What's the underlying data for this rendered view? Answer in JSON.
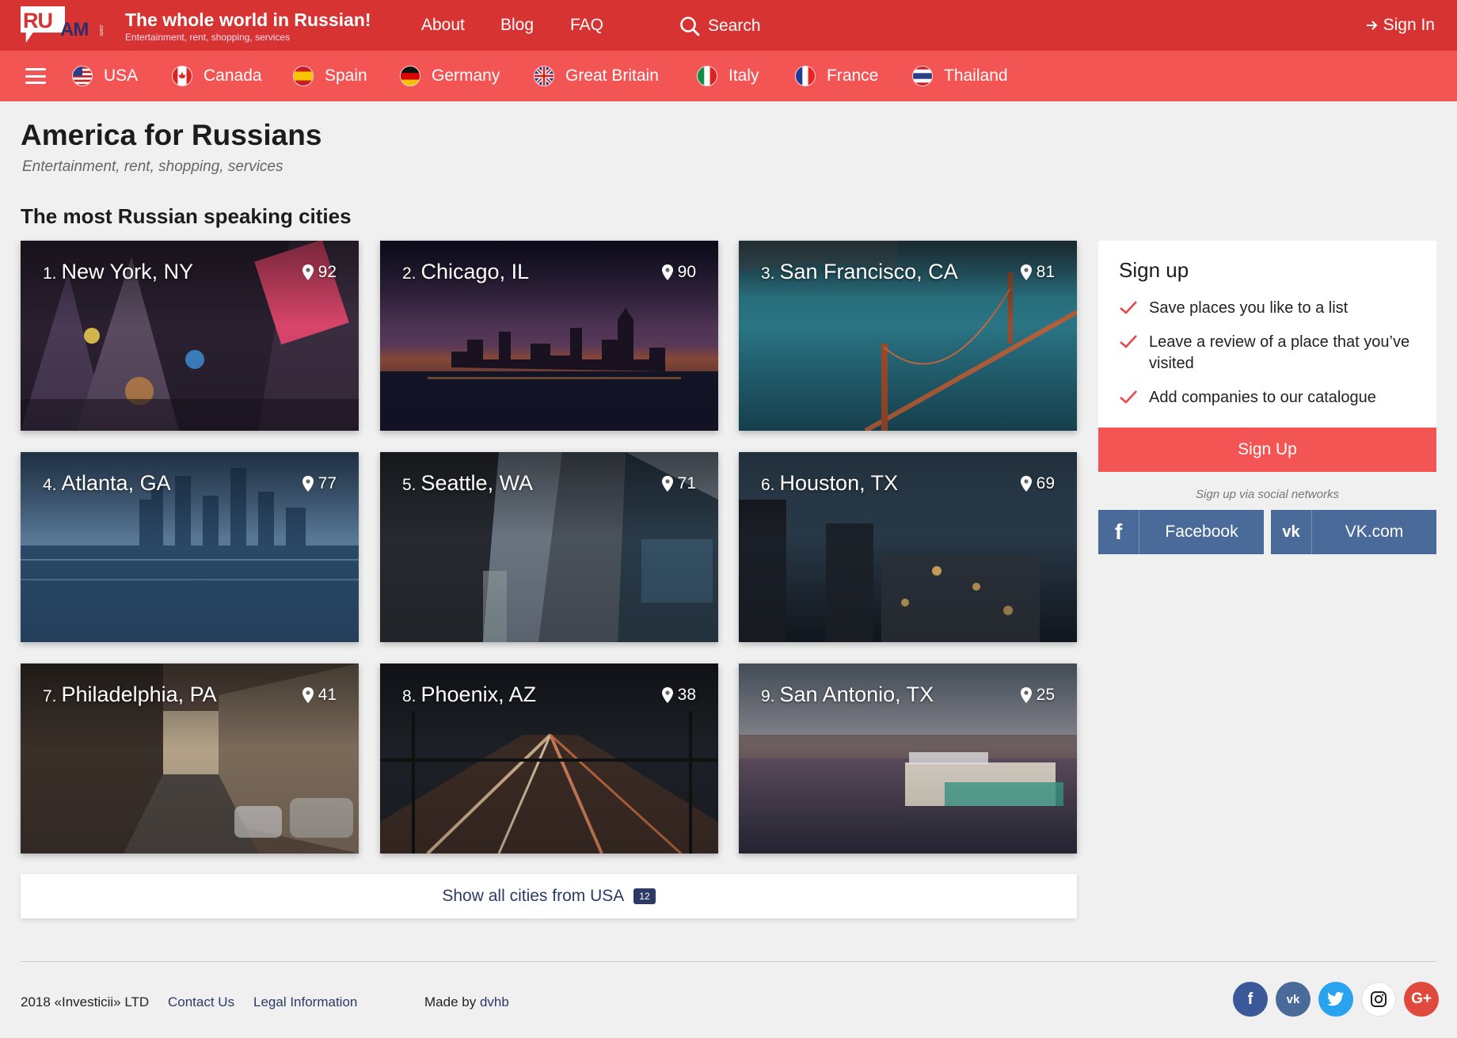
{
  "header": {
    "logo_ru": "RU",
    "logo_am": "AM",
    "logo_dot": ".com",
    "title": "The whole world in Russian!",
    "subtitle": "Entertainment, rent, shopping, services",
    "nav": [
      "About",
      "Blog",
      "FAQ"
    ],
    "search_label": "Search",
    "signin_label": "Sign In"
  },
  "countries": [
    "USA",
    "Canada",
    "Spain",
    "Germany",
    "Great Britain",
    "Italy",
    "France",
    "Thailand"
  ],
  "page": {
    "title": "America for Russians",
    "subtitle": "Entertainment, rent, shopping, services",
    "section_title": "The most Russian speaking cities"
  },
  "cities": [
    {
      "num": "1.",
      "name": "New York, NY",
      "count": "92"
    },
    {
      "num": "2.",
      "name": "Chicago, IL",
      "count": "90"
    },
    {
      "num": "3.",
      "name": "San Francisco, CA",
      "count": "81"
    },
    {
      "num": "4.",
      "name": "Atlanta, GA",
      "count": "77"
    },
    {
      "num": "5.",
      "name": "Seattle, WA",
      "count": "71"
    },
    {
      "num": "6.",
      "name": "Houston, TX",
      "count": "69"
    },
    {
      "num": "7.",
      "name": "Philadelphia, PA",
      "count": "41"
    },
    {
      "num": "8.",
      "name": "Phoenix, AZ",
      "count": "38"
    },
    {
      "num": "9.",
      "name": "San Antonio, TX",
      "count": "25"
    }
  ],
  "show_all": {
    "label": "Show all cities from USA",
    "badge": "12"
  },
  "signup": {
    "title": "Sign up",
    "benefits": [
      "Save places you like to a list",
      "Leave a review of a place that you’ve visited",
      "Add companies to our catalogue"
    ],
    "button": "Sign Up",
    "social_note": "Sign up via social networks",
    "facebook": "Facebook",
    "vk": "VK.com"
  },
  "footer": {
    "copyright": "2018 «Investicii» LTD",
    "contact": "Contact Us",
    "legal": "Legal Information",
    "made_by_prefix": "Made by",
    "made_by_link": "dvhb"
  },
  "colors": {
    "header_red": "#d83333",
    "nav_red": "#f35454",
    "navy": "#2c3a66",
    "social_blue": "#4a6b9a"
  }
}
